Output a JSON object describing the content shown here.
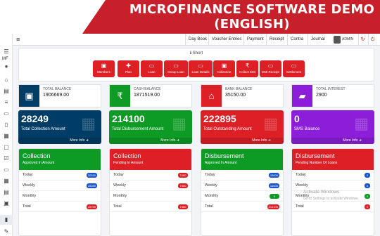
{
  "banner": {
    "title_line1": "MICROFINANCE SOFTWARE DEMO",
    "title_line2": "(ENGLISH)"
  },
  "sidebar": {
    "mf_label": "MF"
  },
  "topnav": {
    "items": [
      "Day Book",
      "Voucher Entries",
      "Payment",
      "Receipt",
      "Contra",
      "Journal"
    ],
    "user_label": "ADMIN"
  },
  "short": {
    "title": "Short",
    "buttons": [
      {
        "label": "Members",
        "icon": "members-icon"
      },
      {
        "label": "Plan",
        "icon": "plus-icon"
      },
      {
        "label": "Loan",
        "icon": "loan-icon"
      },
      {
        "label": "Group Loan",
        "icon": "loan-icon"
      },
      {
        "label": "Loan Details",
        "icon": "loan-icon"
      },
      {
        "label": "Collection",
        "icon": "cash-icon"
      },
      {
        "label": "Collect EMI",
        "icon": "rupee-icon"
      },
      {
        "label": "EMI Receipt",
        "icon": "loan-icon"
      },
      {
        "label": "Settlement",
        "icon": "loan-icon"
      }
    ]
  },
  "stats": [
    {
      "label": "TOTAL BALANCE",
      "value": "1906669.00",
      "color": "#003d66",
      "icon": "money-icon"
    },
    {
      "label": "CASH BALANCE",
      "value": "1871519.00",
      "color": "#0d9b25",
      "icon": "rupee-icon"
    },
    {
      "label": "BANK BALANCE",
      "value": "35150.00",
      "color": "#dd1f26",
      "icon": "bank-icon"
    },
    {
      "label": "TOTAL INTEREST",
      "value": "2900",
      "color": "#8c1ed9",
      "icon": "briefcase-icon"
    }
  ],
  "summary": [
    {
      "value": "28249",
      "label": "Total Collection Amount",
      "more": "More Info",
      "color": "#003d66"
    },
    {
      "value": "214100",
      "label": "Total Disbursement Amount",
      "more": "More Info",
      "color": "#0d9b25"
    },
    {
      "value": "222895",
      "label": "Total Outstanding Amount",
      "more": "More Info",
      "color": "#dd1f26"
    },
    {
      "value": "0",
      "label": "SMS Balance",
      "more": "More Info",
      "color": "#8c1ed9"
    }
  ],
  "panels": [
    {
      "title": "Collection",
      "subtitle": "Approved In Amount",
      "color": "#0d9b25",
      "rows": [
        {
          "label": "Today",
          "value": "20310"
        },
        {
          "label": "Weekly",
          "value": "28289"
        },
        {
          "label": "Monthly",
          "value": ""
        },
        {
          "label": "Total",
          "value": "28759"
        }
      ]
    },
    {
      "title": "Collection",
      "subtitle": "Pending In Amount",
      "color": "#dd1f26",
      "rows": [
        {
          "label": "Today",
          "value": "7480"
        },
        {
          "label": "Weekly",
          "value": "7480"
        },
        {
          "label": "Monthly",
          "value": ""
        },
        {
          "label": "Total",
          "value": "7480"
        }
      ]
    },
    {
      "title": "Disbursement",
      "subtitle": "Approved In Amount",
      "color": "#0d9b25",
      "rows": [
        {
          "label": "Today",
          "value": "15000"
        },
        {
          "label": "Weekly",
          "value": "15000"
        },
        {
          "label": "Monthly",
          "value": "0"
        },
        {
          "label": "Total",
          "value": "214100"
        }
      ]
    },
    {
      "title": "Disbursement",
      "subtitle": "Pending Number Of Loans",
      "color": "#dd1f26",
      "rows": [
        {
          "label": "Today",
          "value": "0"
        },
        {
          "label": "Weekly",
          "value": "0"
        },
        {
          "label": "Monthly",
          "value": "0"
        },
        {
          "label": "Total",
          "value": "0"
        }
      ]
    }
  ],
  "watermark": {
    "line1": "Activate Windows",
    "line2": "Go to Settings to activate Windows."
  }
}
